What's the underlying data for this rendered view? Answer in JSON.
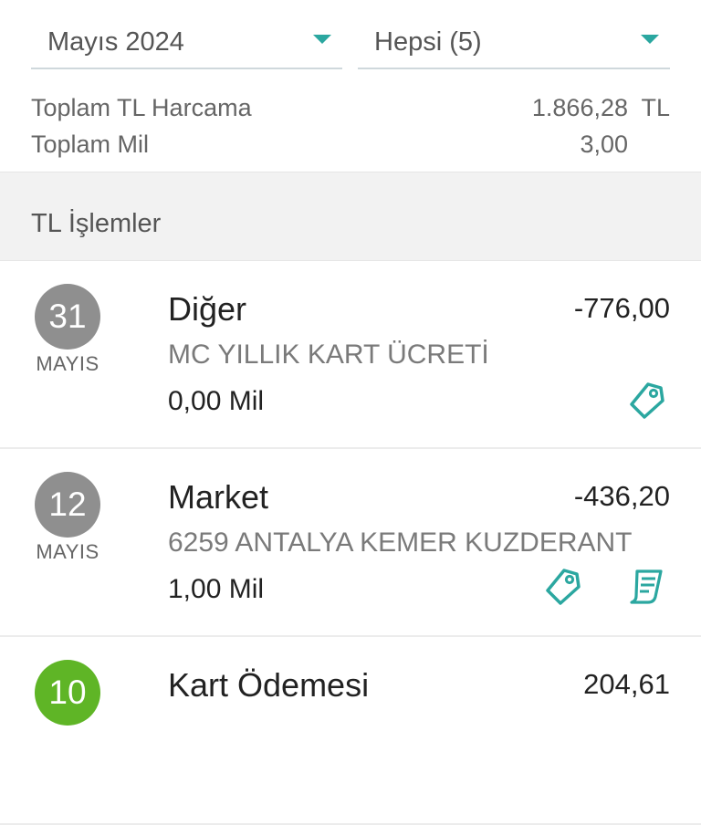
{
  "filters": {
    "month": "Mayıs 2024",
    "type": "Hepsi (5)"
  },
  "totals": {
    "spend_label": "Toplam TL Harcama",
    "spend_value": "1.866,28",
    "spend_unit": "TL",
    "miles_label": "Toplam Mil",
    "miles_value": "3,00"
  },
  "section": {
    "title": "TL İşlemler"
  },
  "transactions": [
    {
      "day": "31",
      "month": "MAYIS",
      "category": "Diğer",
      "amount": "-776,00",
      "description": "MC YILLIK KART ÜCRETİ",
      "miles": "0,00 Mil",
      "icons": [
        "tag-icon"
      ],
      "day_color": "#8f8f8f"
    },
    {
      "day": "12",
      "month": "MAYIS",
      "category": "Market",
      "amount": "-436,20",
      "description": "6259 ANTALYA KEMER KUZDERANT",
      "miles": "1,00 Mil",
      "icons": [
        "tag-icon",
        "receipt-icon"
      ],
      "day_color": "#8f8f8f"
    },
    {
      "day": "10",
      "month": "",
      "category": "Kart Ödemesi",
      "amount": "204,61",
      "description": "",
      "miles": "",
      "icons": [],
      "day_color": "#5fb526"
    }
  ],
  "colors": {
    "accent": "#2ba7a0",
    "section_bg": "#f2f2f2"
  }
}
